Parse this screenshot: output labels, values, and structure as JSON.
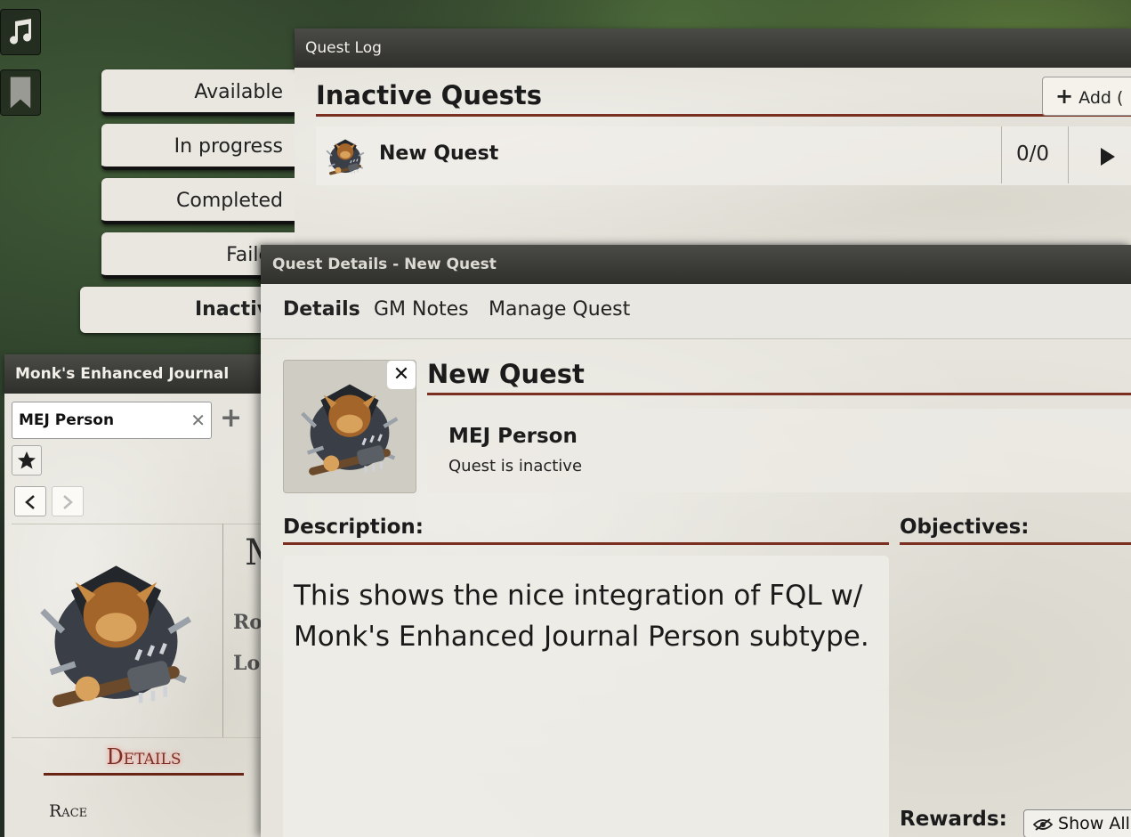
{
  "toolbar": {
    "music_icon": "music-note-icon",
    "bookmark_icon": "bookmark-icon"
  },
  "quest_log": {
    "title": "Quest Log",
    "section_heading": "Inactive Quests",
    "add_button_label": "Add (",
    "tabs": [
      {
        "label": "Available"
      },
      {
        "label": "In progress"
      },
      {
        "label": "Completed"
      },
      {
        "label": "Failed"
      },
      {
        "label": "Inactive"
      }
    ],
    "quests": [
      {
        "name": "New Quest",
        "progress": "0/0"
      }
    ]
  },
  "journal": {
    "title": "Monk's Enhanced Journal",
    "tab_label": "MEJ Person",
    "name_initial": "M",
    "field_role": "Rol",
    "field_location": "Loc",
    "details_heading": "Details",
    "race_label": "Race"
  },
  "quest_details": {
    "title": "Quest Details - New Quest",
    "tabs": [
      {
        "label": "Details"
      },
      {
        "label": "GM Notes"
      },
      {
        "label": "Manage Quest"
      }
    ],
    "quest_name": "New Quest",
    "giver_name": "MEJ Person",
    "status_text": "Quest is inactive",
    "description_heading": "Description:",
    "description_text": "This shows the nice integration of FQL w/ Monk's Enhanced Journal Person subtype.",
    "objectives_heading": "Objectives:",
    "rewards_heading": "Rewards:",
    "show_all_label": "Show All"
  },
  "colors": {
    "accent_rule": "#7a2f21",
    "parchment": "#e6e4dc",
    "header_dark": "#3a3a37"
  }
}
